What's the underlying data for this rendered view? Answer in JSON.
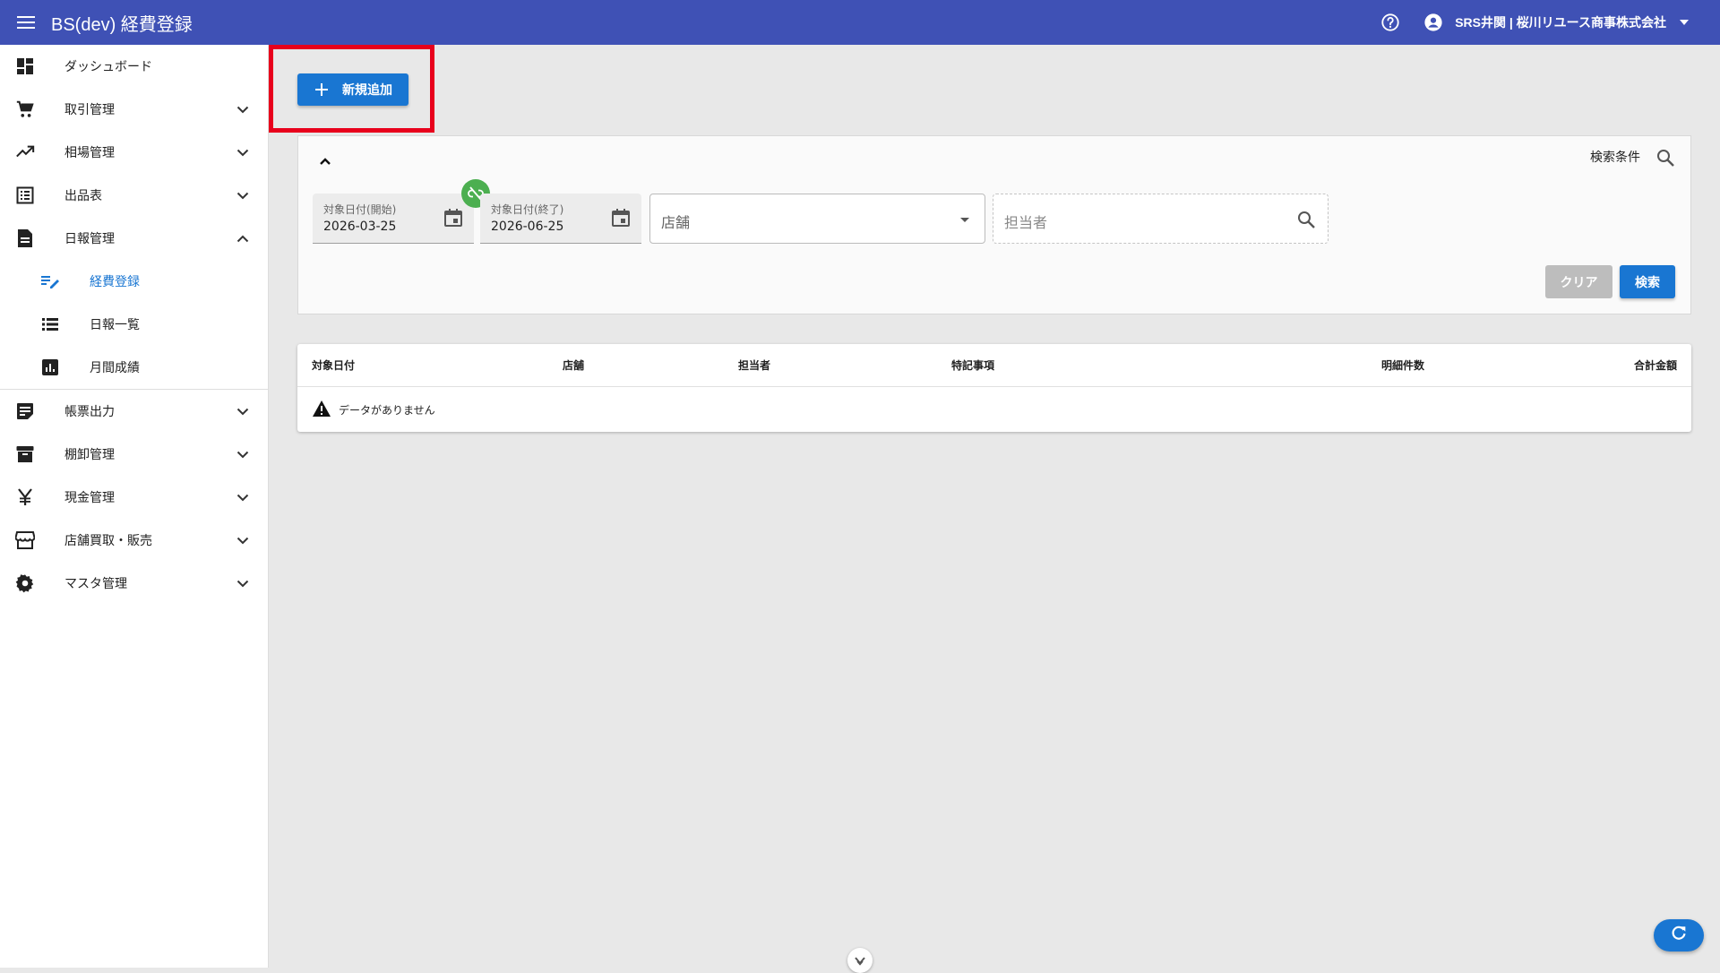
{
  "app": {
    "title": "BS(dev) 経費登録",
    "user_label": "SRS井関 | 桜川リユース商事株式会社"
  },
  "sidebar": {
    "items": [
      {
        "label": "ダッシュボード",
        "icon": "dashboard-icon"
      },
      {
        "label": "取引管理",
        "icon": "cart-icon"
      },
      {
        "label": "相場管理",
        "icon": "trending-up-icon"
      },
      {
        "label": "出品表",
        "icon": "list-icon"
      },
      {
        "label": "日報管理",
        "icon": "document-icon"
      },
      {
        "label": "経費登録",
        "icon": "edit-list-icon"
      },
      {
        "label": "日報一覧",
        "icon": "list-view-icon"
      },
      {
        "label": "月間成績",
        "icon": "bar-chart-icon"
      },
      {
        "label": "帳票出力",
        "icon": "note-icon"
      },
      {
        "label": "棚卸管理",
        "icon": "archive-icon"
      },
      {
        "label": "現金管理",
        "icon": "yen-icon"
      },
      {
        "label": "店舗買取・販売",
        "icon": "store-icon"
      },
      {
        "label": "マスタ管理",
        "icon": "gear-icon"
      }
    ]
  },
  "toolbar": {
    "add_label": "新規追加"
  },
  "search": {
    "conditions_label": "検索条件",
    "start_date_label": "対象日付(開始)",
    "start_date_value": "2026-03-25",
    "end_date_label": "対象日付(終了)",
    "end_date_value": "2026-06-25",
    "store_placeholder": "店舗",
    "staff_placeholder": "担当者",
    "clear_label": "クリア",
    "search_label": "検索"
  },
  "table": {
    "columns": [
      "対象日付",
      "店舗",
      "担当者",
      "特記事項",
      "明細件数",
      "合計金額"
    ],
    "empty_message": "データがありません"
  },
  "colors": {
    "appbar": "#3f51b5",
    "primary": "#1976d2",
    "highlight": "#e8001c",
    "link_badge": "#4caf50"
  }
}
